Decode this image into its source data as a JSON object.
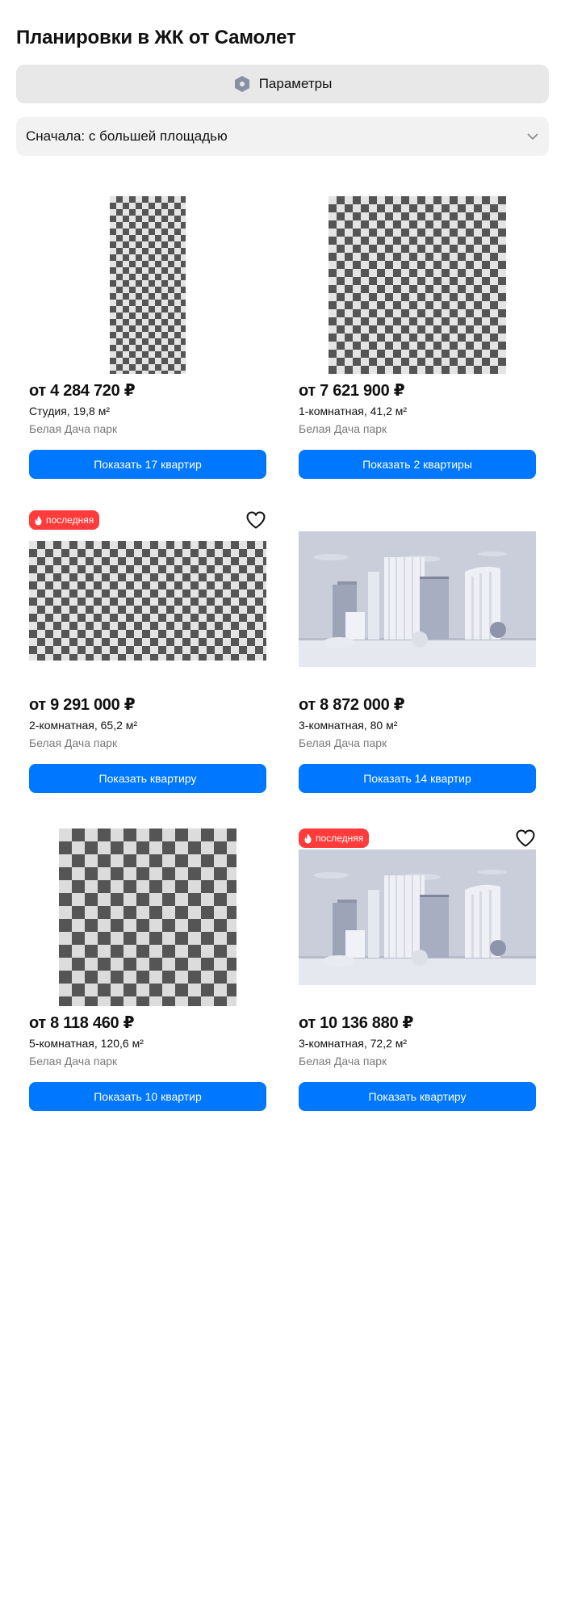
{
  "page": {
    "title": "Планировки в ЖК от Самолет"
  },
  "filters": {
    "params_label": "Параметры",
    "params_icon": "hexagon-settings-icon"
  },
  "sort": {
    "selected": "Сначала: с большей площадью",
    "icon": "chevron-down-icon"
  },
  "colors": {
    "accent": "#0077ff",
    "badge": "#ff3b3b",
    "muted_text": "#7a7a7a"
  },
  "cards": [
    {
      "price": "от 4 284 720 ₽",
      "rooms": "Студия, 19,8 м²",
      "complex": "Белая Дача парк",
      "button": "Показать 17 квартир",
      "image": "floor-plan-placeholder"
    },
    {
      "price": "от 7 621 900 ₽",
      "rooms": "1-комнатная, 41,2 м²",
      "complex": "Белая Дача парк",
      "button": "Показать 2 квартиры",
      "image": "floor-plan-placeholder"
    },
    {
      "price": "от 9 291 000 ₽",
      "rooms": "2-комнатная, 65,2 м²",
      "complex": "Белая Дача парк",
      "button": "Показать квартиру",
      "badge": "последняя",
      "favorite": true,
      "image": "floor-plan-placeholder"
    },
    {
      "price": "от 8 872 000 ₽",
      "rooms": "3-комнатная, 80 м²",
      "complex": "Белая Дача парк",
      "button": "Показать 14 квартир",
      "image": "building-illustration"
    },
    {
      "price": "от 8 118 460 ₽",
      "rooms": "5-комнатная, 120,6 м²",
      "complex": "Белая Дача парк",
      "button": "Показать 10 квартир",
      "image": "floor-plan-placeholder"
    },
    {
      "price": "от 10 136 880 ₽",
      "rooms": "3-комнатная, 72,2 м²",
      "complex": "Белая Дача парк",
      "button": "Показать квартиру",
      "badge": "последняя",
      "favorite": true,
      "image": "building-illustration"
    }
  ]
}
